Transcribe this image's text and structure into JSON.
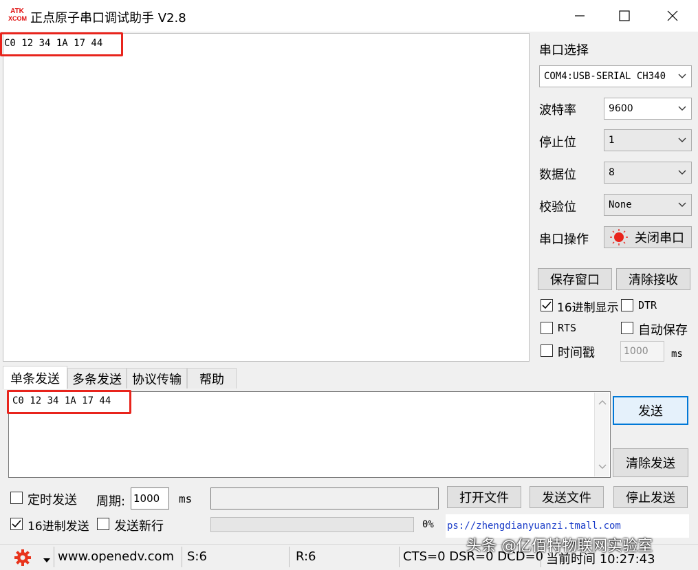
{
  "window": {
    "logo_top": "ATK",
    "logo_bottom": "XCOM",
    "title": "正点原子串口调试助手 V2.8"
  },
  "receive": {
    "text": "C0 12 34 1A 17 44"
  },
  "settings": {
    "port_label": "串口选择",
    "port_value": "COM4:USB-SERIAL CH340",
    "baud_label": "波特率",
    "baud_value": "9600",
    "stop_label": "停止位",
    "stop_value": "1",
    "data_label": "数据位",
    "data_value": "8",
    "parity_label": "校验位",
    "parity_value": "None",
    "op_label": "串口操作",
    "close_port": "关闭串口",
    "save_window": "保存窗口",
    "clear_recv": "清除接收",
    "hex_display": "16进制显示",
    "hex_display_checked": true,
    "dtr": "DTR",
    "rts": "RTS",
    "auto_save": "自动保存",
    "timestamp": "时间戳",
    "timestamp_value": "1000",
    "ms": "ms"
  },
  "tabs": [
    "单条发送",
    "多条发送",
    "协议传输",
    "帮助"
  ],
  "send": {
    "text": "C0 12 34 1A 17 44",
    "send_button": "发送",
    "clear_send": "清除发送",
    "timed_send": "定时发送",
    "period_label": "周期:",
    "period_value": "1000",
    "period_unit": "ms",
    "open_file": "打开文件",
    "send_file": "发送文件",
    "stop_send": "停止发送",
    "hex_send": "16进制发送",
    "hex_send_checked": true,
    "newline": "发送新行",
    "progress_text": "0%",
    "progress": 0,
    "link": "ps://zhengdianyuanzi.tmall.com"
  },
  "status": {
    "url": "www.openedv.com",
    "sent": "S:6",
    "recv": "R:6",
    "signals": "CTS=0 DSR=0 DCD=0",
    "time": "当前时间 10:27:43",
    "watermark": "头条 @亿佰特物联网实验室"
  },
  "colors": {
    "accent_red": "#e8241c",
    "link_blue": "#1a3cc8"
  }
}
